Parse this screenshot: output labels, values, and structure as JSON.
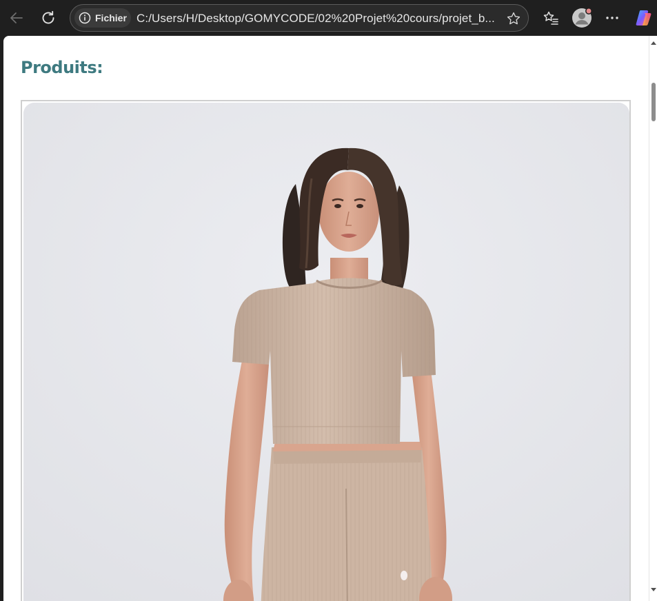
{
  "browser": {
    "site_info_label": "Fichier",
    "address": "C:/Users/H/Desktop/GOMYCODE/02%20Projet%20cours/projet_b..."
  },
  "page": {
    "heading": "Produits:"
  },
  "product": {
    "image_alt": "Product photo of a woman wearing a beige ribbed crop top and matching shorts"
  },
  "colors": {
    "heading": "#3e7a80",
    "toolbar_bg": "#1f1f1f",
    "photo_bg": "#e6e7eb",
    "garment": "#cdb7a6"
  }
}
